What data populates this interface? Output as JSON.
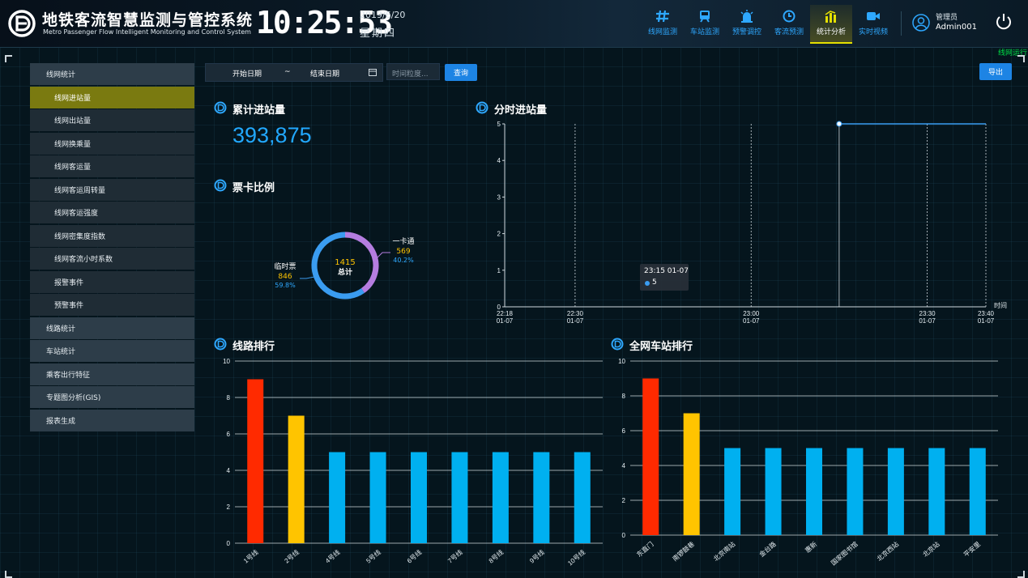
{
  "header": {
    "title": "地铁客流智慧监测与管控系统",
    "subtitle": "Metro Passenger Flow Intelligent Monitoring and Control System",
    "clock": "10:25:53",
    "date": "2019/6/20",
    "weekday": "星期四",
    "nav": [
      {
        "label": "线网监测",
        "icon": "network-hash-icon",
        "active": false
      },
      {
        "label": "车站监测",
        "icon": "train-icon",
        "active": false
      },
      {
        "label": "预警调控",
        "icon": "alarm-light-icon",
        "active": false
      },
      {
        "label": "客流预测",
        "icon": "clock-icon",
        "active": false
      },
      {
        "label": "统计分析",
        "icon": "bar-chart-icon",
        "active": true
      },
      {
        "label": "实时视频",
        "icon": "video-camera-icon",
        "active": false
      }
    ],
    "user_role": "管理员",
    "user_name": "Admin001",
    "marquee": "线网运行"
  },
  "sidebar": {
    "items": [
      {
        "label": "线网统计",
        "level": "group",
        "active": false
      },
      {
        "label": "线网进站量",
        "level": "sub",
        "active": true
      },
      {
        "label": "线网出站量",
        "level": "sub",
        "active": false
      },
      {
        "label": "线网换乘量",
        "level": "sub",
        "active": false
      },
      {
        "label": "线网客运量",
        "level": "sub",
        "active": false
      },
      {
        "label": "线网客运周转量",
        "level": "sub",
        "active": false
      },
      {
        "label": "线网客运强度",
        "level": "sub",
        "active": false
      },
      {
        "label": "线网密集度指数",
        "level": "sub",
        "active": false
      },
      {
        "label": "线网客流小时系数",
        "level": "sub",
        "active": false
      },
      {
        "label": "报警事件",
        "level": "sub",
        "active": false
      },
      {
        "label": "预警事件",
        "level": "sub",
        "active": false
      },
      {
        "label": "线路统计",
        "level": "group",
        "active": false
      },
      {
        "label": "车站统计",
        "level": "group",
        "active": false
      },
      {
        "label": "乘客出行特征",
        "level": "group",
        "active": false
      },
      {
        "label": "专题图分析(GIS)",
        "level": "group",
        "active": false
      },
      {
        "label": "报表生成",
        "level": "group",
        "active": false
      }
    ]
  },
  "toolbar": {
    "start_date": "开始日期",
    "separator": "~",
    "end_date": "结束日期",
    "granularity_placeholder": "时间粒度...",
    "query_label": "查询",
    "export_label": "导出"
  },
  "panels": {
    "cumulative_title": "累计进站量",
    "cumulative_value": "393,875",
    "ticket_title": "票卡比例",
    "timeline_title": "分时进站量",
    "line_rank_title": "线路排行",
    "station_rank_title": "全网车站排行"
  },
  "colors": {
    "accent": "#1d84e4",
    "highlight_red": "#ff2a00",
    "highlight_yellow": "#ffc400",
    "bar_blue": "#00b0f0",
    "active_nav": "#e5e000",
    "active_side": "#7a7a10"
  },
  "chart_data": [
    {
      "type": "pie",
      "title": "票卡比例",
      "center_value": "1415",
      "center_label": "总计",
      "slices": [
        {
          "name": "一卡通",
          "value": 569,
          "percent": "40.2%",
          "color": "#b57de0"
        },
        {
          "name": "临时票",
          "value": 846,
          "percent": "59.8%",
          "color": "#3a9cf0"
        }
      ]
    },
    {
      "type": "line",
      "title": "分时进站量",
      "xlabel": "时间",
      "x_ticks": [
        {
          "time": "22:18",
          "date": "01-07"
        },
        {
          "time": "22:30",
          "date": "01-07"
        },
        {
          "time": "23:00",
          "date": "01-07"
        },
        {
          "time": "23:30",
          "date": "01-07"
        },
        {
          "time": "23:40",
          "date": "01-07"
        }
      ],
      "ylim": [
        0,
        5
      ],
      "y_ticks": [
        0,
        1,
        2,
        3,
        4,
        5
      ],
      "points": [
        {
          "x": "23:15",
          "y": 5
        },
        {
          "x": "23:40",
          "y": 5
        }
      ],
      "tooltip": {
        "title": "23:15 01-07",
        "value": "5"
      }
    },
    {
      "type": "bar",
      "title": "线路排行",
      "categories": [
        "1号线",
        "2号线",
        "4号线",
        "5号线",
        "6号线",
        "7号线",
        "8号线",
        "9号线",
        "10号线"
      ],
      "values": [
        9,
        7,
        5,
        5,
        5,
        5,
        5,
        5,
        5
      ],
      "ylim": [
        0,
        10
      ],
      "y_ticks": [
        0,
        2,
        4,
        6,
        8,
        10
      ]
    },
    {
      "type": "bar",
      "title": "全网车站排行",
      "categories": [
        "东直门",
        "南锣鼓巷",
        "北京南站",
        "金台路",
        "惠新",
        "国家图书馆",
        "北京西站",
        "北京站",
        "平安里"
      ],
      "values": [
        9,
        7,
        5,
        5,
        5,
        5,
        5,
        5,
        5
      ],
      "ylim": [
        0,
        10
      ],
      "y_ticks": [
        0,
        2,
        4,
        6,
        8,
        10
      ]
    }
  ]
}
